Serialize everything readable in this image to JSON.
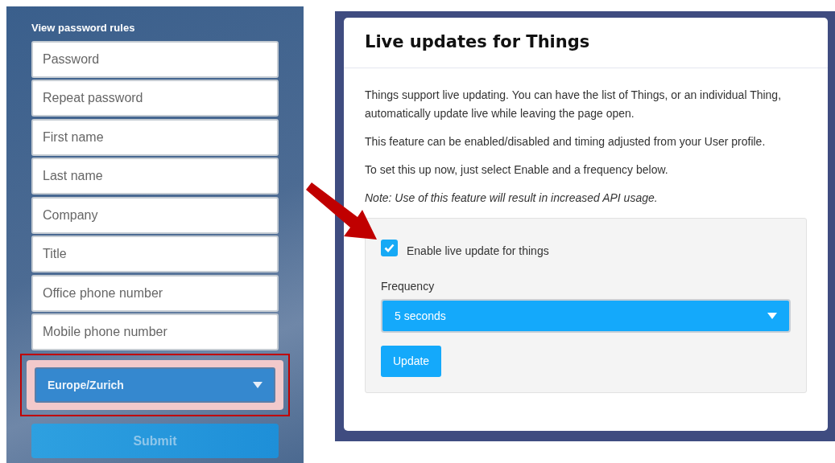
{
  "signup_form": {
    "rules_link": "View password rules",
    "fields": [
      {
        "placeholder": "Password"
      },
      {
        "placeholder": "Repeat password"
      },
      {
        "placeholder": "First name"
      },
      {
        "placeholder": "Last name"
      },
      {
        "placeholder": "Company"
      },
      {
        "placeholder": "Title"
      },
      {
        "placeholder": "Office phone number"
      },
      {
        "placeholder": "Mobile phone number"
      }
    ],
    "timezone_select": {
      "value": "Europe/Zurich",
      "highlighted": true
    },
    "submit_button": {
      "label": "Submit",
      "disabled": true
    }
  },
  "dialog": {
    "title": "Live updates for Things",
    "paragraphs": [
      {
        "text": "Things support live updating. You can have the list of Things, or an individual Thing, automatically update live while leaving the page open.",
        "italic": false
      },
      {
        "text": "This feature can be enabled/disabled and timing adjusted from your User profile.",
        "italic": false
      },
      {
        "text": "To set this up now, just select Enable and a frequency below.",
        "italic": false
      },
      {
        "text": "Note: Use of this feature will result in increased API usage.",
        "italic": true
      }
    ],
    "enable_checkbox": {
      "label": "Enable live update for things",
      "checked": true
    },
    "frequency": {
      "label": "Frequency",
      "value": "5 seconds"
    },
    "update_button": {
      "label": "Update"
    }
  }
}
